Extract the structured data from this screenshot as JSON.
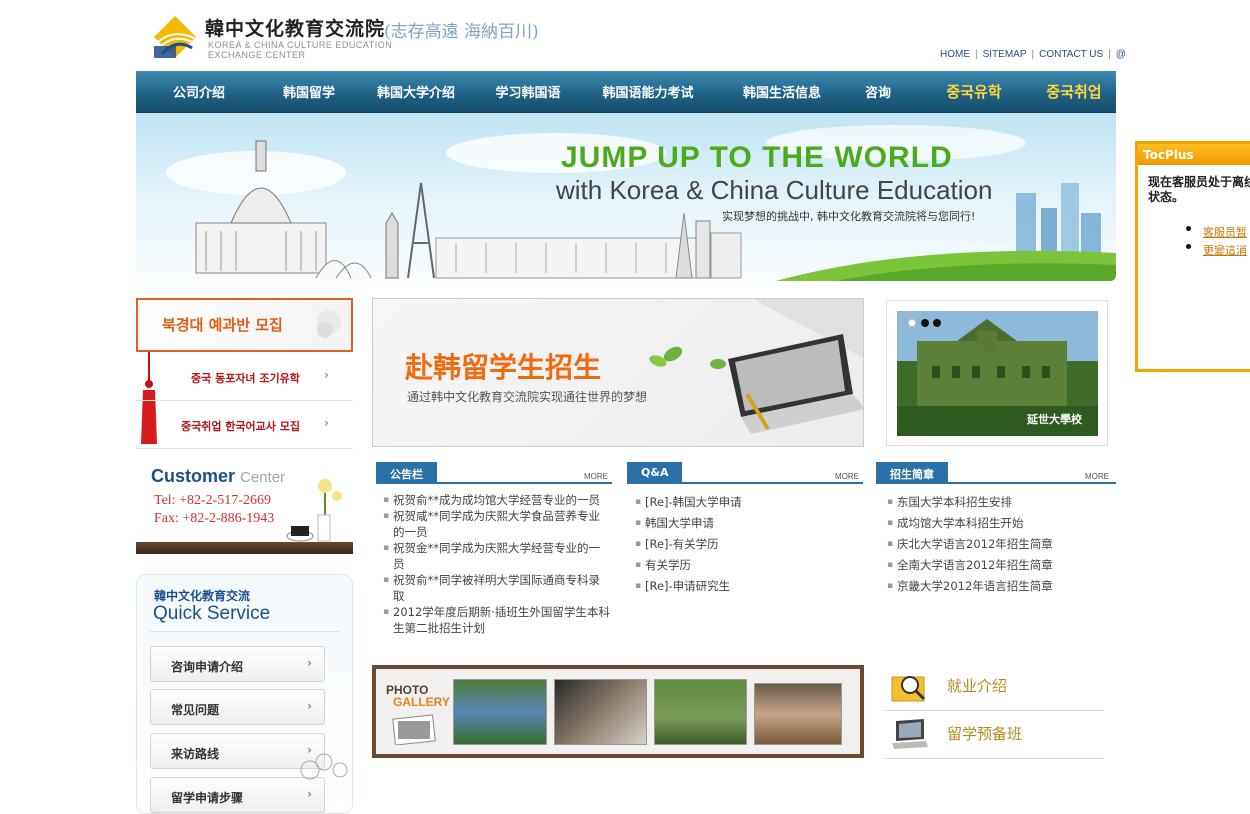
{
  "header": {
    "logo_cn": "韓中文化教育交流院",
    "logo_en_line1": "KOREA & CHINA CULTURE  EDUCATION",
    "logo_en_line2": "EXCHANGE CENTER",
    "slogan": "(志存高遠 海納百川)",
    "links": [
      "HOME",
      "SITEMAP",
      "CONTACT US",
      "@"
    ]
  },
  "nav": {
    "items": [
      "公司介绍",
      "韩国留学",
      "韩国大学介绍",
      "学习韩国语",
      "韩国语能力考试",
      "韩国生活信息",
      "咨询",
      "중국유학",
      "중국취업"
    ]
  },
  "banner": {
    "title1": "JUMP UP  TO THE WORLD",
    "title2": "with Korea & China Culture Education",
    "subtitle": "实现梦想的挑战中, 韩中文化教育交流院将与您同行!"
  },
  "left": {
    "promo_main": "북경대 예과반 모집",
    "promo_items": [
      "중국 동포자녀 조기유학",
      "중국취업 한국어교사 모집"
    ],
    "arrow": "›",
    "customer": {
      "title": "Customer",
      "title_light": "Center",
      "tel": "Tel:   +82-2-517-2669",
      "fax": "Fax:  +82-2-886-1943"
    },
    "quick": {
      "subtitle": "韓中文化教育交流",
      "title": "Quick Service",
      "buttons": [
        "咨询申请介绍",
        "常见问题",
        "来访路线",
        "留学申请步骤"
      ]
    }
  },
  "center_banner": {
    "title": "赴韩留学生招生",
    "subtitle": "通过韩中文化教育交流院实现通往世界的梦想"
  },
  "right_photo": {
    "caption": "延世大學校"
  },
  "boards": {
    "more": "MORE",
    "notice": {
      "title": "公告栏",
      "items": [
        "祝贺俞**成为成均馆大学经营专业的一员",
        "祝贺咸**同学成为庆熙大学食品营养专业的一员",
        "祝贺金**同学成为庆熙大学经营专业的一员",
        "祝贺俞**同学被祥明大学国际通商专科录取",
        "2012学年度后期新·插班生外国留学生本科生第二批招生计划"
      ]
    },
    "qa": {
      "title": "Q&A",
      "items": [
        "[Re]-韩国大学申请",
        "韩国大学申请",
        "[Re]-有关学历",
        "有关学历",
        "[Re]-申请研究生"
      ]
    },
    "admission": {
      "title": "招生简章",
      "items": [
        "东国大学本科招生安排",
        "成均馆大学本科招生开始",
        "庆北大学语言2012年招生简章",
        "全南大学语言2012年招生简章",
        "京畿大学2012年语言招生简章"
      ]
    }
  },
  "gallery": {
    "label1": "PHOTO",
    "label2": "GALLERY"
  },
  "right_links": [
    "就业介绍",
    "留学预备班"
  ],
  "tocplus": {
    "title": "TocPlus",
    "message": "现在客服员处于离线状态。",
    "links": [
      "客服员暂",
      "更變這消"
    ]
  },
  "colors": {
    "nav": "#1e5f83",
    "accent_orange": "#f06a0f",
    "board_blue": "#2a71a8",
    "toc_orange": "#f2a600"
  }
}
